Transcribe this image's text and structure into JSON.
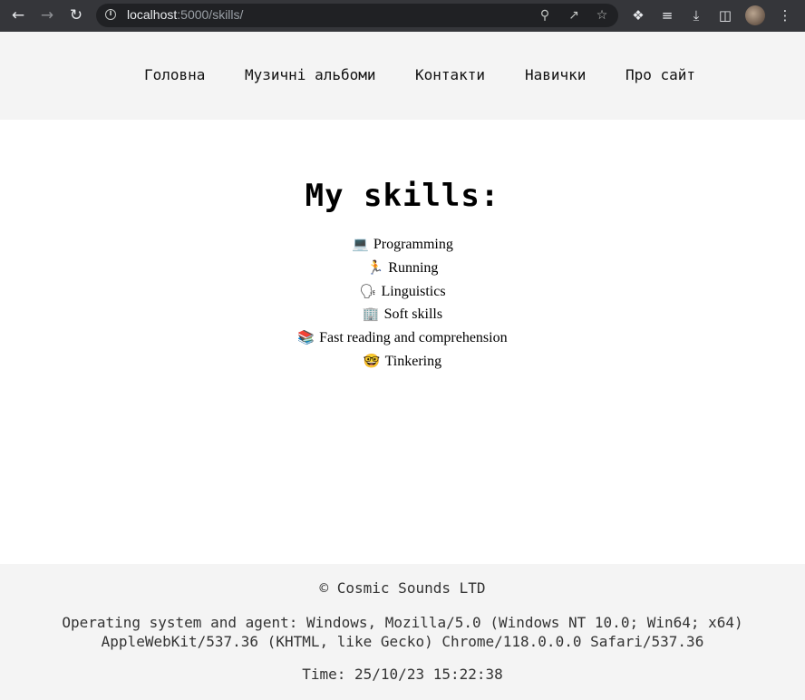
{
  "browser": {
    "url_host": "localhost",
    "url_path": ":5000/skills/"
  },
  "nav": {
    "items": [
      {
        "label": "Головна"
      },
      {
        "label": "Музичні альбоми"
      },
      {
        "label": "Контакти"
      },
      {
        "label": "Навички"
      },
      {
        "label": "Про сайт"
      }
    ]
  },
  "main": {
    "title": "My skills:",
    "skills": [
      {
        "emoji": "💻",
        "label": "Programming"
      },
      {
        "emoji": "🏃",
        "label": "Running"
      },
      {
        "emoji": "🗣",
        "label": "Linguistics"
      },
      {
        "emoji": "🏢",
        "label": "Soft skills"
      },
      {
        "emoji": "📚",
        "label": "Fast reading and comprehension"
      },
      {
        "emoji": "🤓",
        "label": "Tinkering"
      }
    ]
  },
  "footer": {
    "copyright": "© Cosmic Sounds LTD",
    "agent_line1": "Operating system and agent: Windows, Mozilla/5.0 (Windows NT 10.0; Win64; x64)",
    "agent_line2": "AppleWebKit/537.36 (KHTML, like Gecko) Chrome/118.0.0.0 Safari/537.36",
    "time": "Time: 25/10/23 15:22:38"
  }
}
